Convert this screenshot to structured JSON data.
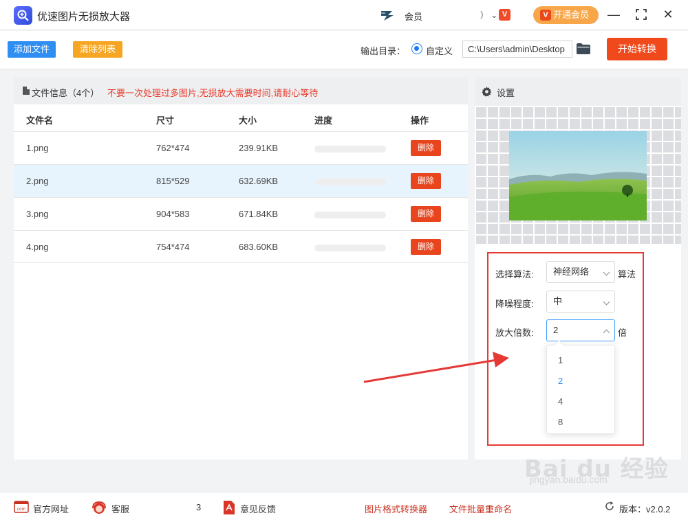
{
  "app": {
    "title": "优速图片无损放大器",
    "vip_label": "会员",
    "user_suffix": "）",
    "open_vip": "开通会员",
    "badge": "V",
    "window_controls": [
      "minimize-icon",
      "maximize-icon",
      "close-icon"
    ]
  },
  "toolbar": {
    "add_files": "添加文件",
    "clear_list": "清除列表",
    "output_label": "输出目录：",
    "radio_custom": "自定义",
    "output_path": "C:\\Users\\admin\\Desktop",
    "start_button": "开始转换"
  },
  "file_panel": {
    "header": "文件信息（4个）",
    "warning": "不要一次处理过多图片,无损放大需要时间,请耐心等待",
    "columns": [
      "文件名",
      "尺寸",
      "大小",
      "进度",
      "操作"
    ],
    "rows": [
      {
        "name": "1.png",
        "size": "762*474",
        "bytes": "239.91KB",
        "progress": 0,
        "action": "删除"
      },
      {
        "name": "2.png",
        "size": "815*529",
        "bytes": "632.69KB",
        "progress": 0,
        "action": "删除"
      },
      {
        "name": "3.png",
        "size": "904*583",
        "bytes": "671.84KB",
        "progress": 0,
        "action": "删除"
      },
      {
        "name": "4.png",
        "size": "754*474",
        "bytes": "683.60KB",
        "progress": 0,
        "action": "删除"
      }
    ]
  },
  "settings": {
    "title": "设置",
    "algorithm_label": "选择算法:",
    "algorithm_value": "神经网络",
    "algorithm_suffix": "算法",
    "denoise_label": "降噪程度:",
    "denoise_value": "中",
    "scale_label": "放大倍数:",
    "scale_value": "2",
    "scale_suffix": "倍",
    "scale_options": [
      "1",
      "2",
      "4",
      "8"
    ],
    "scale_selected": "2"
  },
  "footer": {
    "website": "官方网址",
    "service": "客服",
    "service_tail": "3",
    "feedback": "意见反馈",
    "format_converter": "图片格式转换器",
    "batch_rename": "文件批量重命名",
    "version": "版本：v2.0.2"
  },
  "watermark": {
    "text": "Bai du 经验",
    "url": "jingyan.baidu.com"
  },
  "colors": {
    "primary_blue": "#2e8ef2",
    "orange": "#f6a623",
    "start_red": "#f0491c",
    "delete_red": "#e8451e",
    "warning_red": "#e83b2a",
    "annotation_red": "#e53935",
    "selected_row": "#e8f4fd"
  }
}
